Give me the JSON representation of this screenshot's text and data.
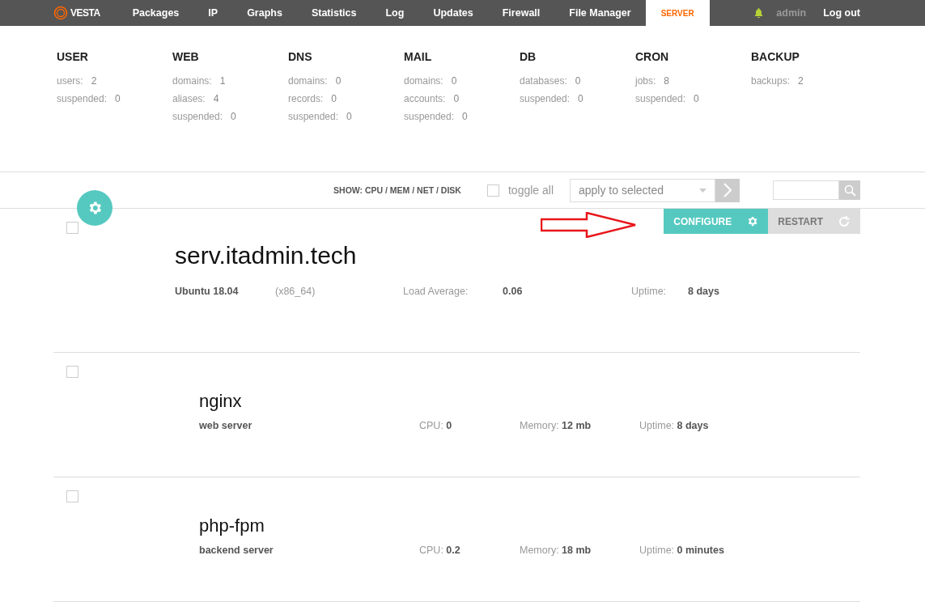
{
  "topbar": {
    "logo": "VESTA",
    "nav": [
      {
        "label": "Packages",
        "selected": false
      },
      {
        "label": "IP",
        "selected": false
      },
      {
        "label": "Graphs",
        "selected": false
      },
      {
        "label": "Statistics",
        "selected": false
      },
      {
        "label": "Log",
        "selected": false
      },
      {
        "label": "Updates",
        "selected": false
      },
      {
        "label": "Firewall",
        "selected": false
      },
      {
        "label": "File Manager",
        "selected": false
      },
      {
        "label": "SERVER",
        "selected": true
      }
    ],
    "user": "admin",
    "logout": "Log out"
  },
  "stats": [
    {
      "title": "USER",
      "rows": [
        {
          "label": "users:",
          "value": "2"
        },
        {
          "label": "suspended:",
          "value": "0"
        }
      ]
    },
    {
      "title": "WEB",
      "rows": [
        {
          "label": "domains:",
          "value": "1"
        },
        {
          "label": "aliases:",
          "value": "4"
        },
        {
          "label": "suspended:",
          "value": "0"
        }
      ]
    },
    {
      "title": "DNS",
      "rows": [
        {
          "label": "domains:",
          "value": "0"
        },
        {
          "label": "records:",
          "value": "0"
        },
        {
          "label": "suspended:",
          "value": "0"
        }
      ]
    },
    {
      "title": "MAIL",
      "rows": [
        {
          "label": "domains:",
          "value": "0"
        },
        {
          "label": "accounts:",
          "value": "0"
        },
        {
          "label": "suspended:",
          "value": "0"
        }
      ]
    },
    {
      "title": "DB",
      "rows": [
        {
          "label": "databases:",
          "value": "0"
        },
        {
          "label": "suspended:",
          "value": "0"
        }
      ]
    },
    {
      "title": "CRON",
      "rows": [
        {
          "label": "jobs:",
          "value": "8"
        },
        {
          "label": "suspended:",
          "value": "0"
        }
      ]
    },
    {
      "title": "BACKUP",
      "rows": [
        {
          "label": "backups:",
          "value": "2"
        }
      ]
    }
  ],
  "toolbar": {
    "show": "SHOW: CPU / MEM / NET / DISK",
    "toggle_all": {
      "label": "toggle all",
      "checked": false
    },
    "action_select": {
      "value": "apply to selected"
    }
  },
  "server": {
    "checked": false,
    "hostname": "serv.itadmin.tech",
    "os": "Ubuntu 18.04",
    "arch": "(x86_64)",
    "load_label": "Load Average:",
    "load_value": "0.06",
    "uptime_label": "Uptime:",
    "uptime_value": "8 days",
    "buttons": [
      {
        "label": "CONFIGURE",
        "kind": "primary"
      },
      {
        "label": "RESTART",
        "kind": "secondary"
      }
    ]
  },
  "services": [
    {
      "checked": false,
      "name": "nginx",
      "description": "web server",
      "cpu": "CPU: **0**",
      "memory": "Memory: **12 mb**",
      "uptime": "Uptime: **8 days**"
    },
    {
      "checked": false,
      "name": "php-fpm",
      "description": "backend server",
      "cpu": "CPU: **0.2**",
      "memory": "Memory: **18 mb**",
      "uptime": "Uptime: **0 minutes**"
    }
  ]
}
